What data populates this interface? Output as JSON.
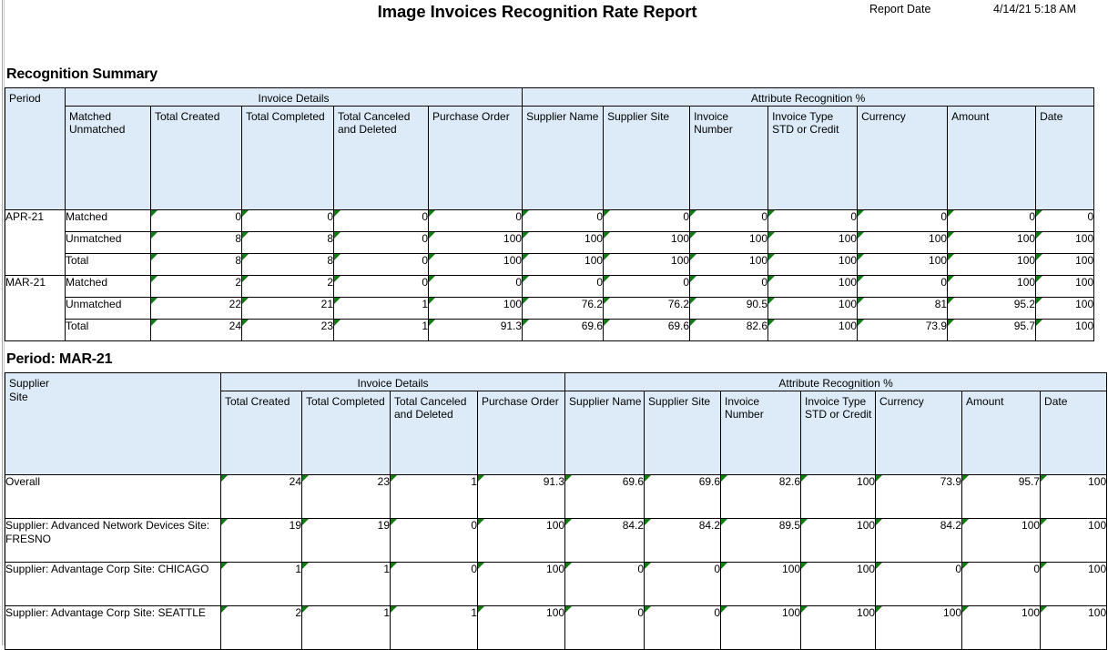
{
  "header": {
    "title": "Image Invoices Recognition Rate Report",
    "report_date_label": "Report Date",
    "report_date_value": "4/14/21 5:18 AM"
  },
  "section1": {
    "title": "Recognition Summary",
    "group_headers": {
      "period": "Period",
      "invoice_details": "Invoice Details",
      "attribute_recognition": "Attribute Recognition %"
    },
    "columns": [
      "Matched Unmatched",
      "Total Created",
      "Total Completed",
      "Total Canceled and Deleted",
      "Purchase Order",
      "Supplier Name",
      "Supplier Site",
      "Invoice Number",
      "Invoice Type STD or Credit",
      "Currency",
      "Amount",
      "Date"
    ],
    "groups": [
      {
        "period": "APR-21",
        "rows": [
          {
            "label": "Matched",
            "values": [
              "0",
              "0",
              "0",
              "0",
              "0",
              "0",
              "0",
              "0",
              "0",
              "0",
              "0"
            ]
          },
          {
            "label": "Unmatched",
            "values": [
              "8",
              "8",
              "0",
              "100",
              "100",
              "100",
              "100",
              "100",
              "100",
              "100",
              "100"
            ]
          },
          {
            "label": "Total",
            "values": [
              "8",
              "8",
              "0",
              "100",
              "100",
              "100",
              "100",
              "100",
              "100",
              "100",
              "100"
            ]
          }
        ]
      },
      {
        "period": "MAR-21",
        "rows": [
          {
            "label": "Matched",
            "values": [
              "2",
              "2",
              "0",
              "0",
              "0",
              "0",
              "0",
              "100",
              "0",
              "100",
              "100"
            ]
          },
          {
            "label": "Unmatched",
            "values": [
              "22",
              "21",
              "1",
              "100",
              "76.2",
              "76.2",
              "90.5",
              "100",
              "81",
              "95.2",
              "100"
            ]
          },
          {
            "label": "Total",
            "values": [
              "24",
              "23",
              "1",
              "91.3",
              "69.6",
              "69.6",
              "82.6",
              "100",
              "73.9",
              "95.7",
              "100"
            ]
          }
        ]
      }
    ]
  },
  "section2": {
    "title": "Period: MAR-21",
    "group_headers": {
      "supplier_site": "Supplier Site",
      "supplier_site_line1": "Supplier",
      "supplier_site_line2": "Site",
      "invoice_details": "Invoice Details",
      "attribute_recognition": "Attribute Recognition %"
    },
    "columns": [
      "Total Created",
      "Total Completed",
      "Total Canceled and Deleted",
      "Purchase Order",
      "Supplier Name",
      "Supplier Site",
      "Invoice Number",
      "Invoice Type STD or Credit",
      "Currency",
      "Amount",
      "Date"
    ],
    "rows": [
      {
        "label": "Overall",
        "bold": true,
        "values": [
          "24",
          "23",
          "1",
          "91.3",
          "69.6",
          "69.6",
          "82.6",
          "100",
          "73.9",
          "95.7",
          "100"
        ]
      },
      {
        "label": "Supplier: Advanced Network Devices Site: FRESNO",
        "bold": false,
        "values": [
          "19",
          "19",
          "0",
          "100",
          "84.2",
          "84.2",
          "89.5",
          "100",
          "84.2",
          "100",
          "100"
        ]
      },
      {
        "label": "Supplier: Advantage Corp Site: CHICAGO",
        "bold": false,
        "values": [
          "1",
          "1",
          "0",
          "100",
          "0",
          "0",
          "100",
          "100",
          "0",
          "0",
          "100"
        ]
      },
      {
        "label": "Supplier: Advantage Corp Site: SEATTLE",
        "bold": false,
        "values": [
          "2",
          "1",
          "1",
          "100",
          "0",
          "0",
          "100",
          "100",
          "100",
          "100",
          "100"
        ]
      }
    ]
  },
  "colors": {
    "header_background": "#dcebf7",
    "border": "#000000",
    "error_triangle": "#127c12",
    "gutter": "#a9a9a9"
  }
}
